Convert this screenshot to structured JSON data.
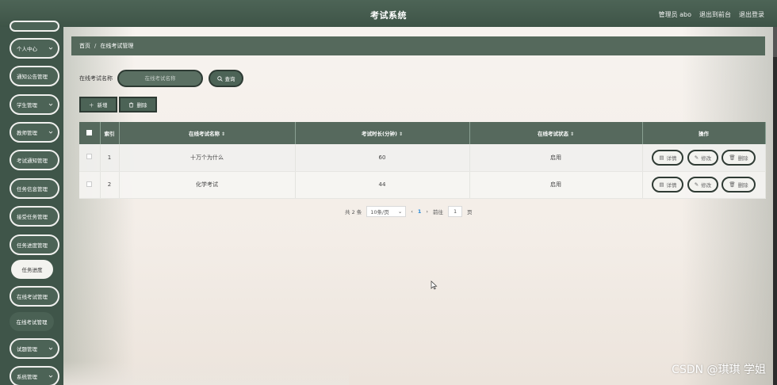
{
  "app": {
    "title": "考试系统",
    "user": "管理员 abo",
    "back_link": "退出到前台",
    "logout": "退出登录"
  },
  "sidebar": {
    "items": [
      {
        "label": "个人中心"
      },
      {
        "label": "通知公告管理"
      },
      {
        "label": "学生管理"
      },
      {
        "label": "教师管理"
      },
      {
        "label": "考试通知管理"
      },
      {
        "label": "任务信息管理"
      },
      {
        "label": "接受任务管理"
      },
      {
        "label": "任务进度管理"
      },
      {
        "label": "任务进度"
      },
      {
        "label": "在线考试管理"
      },
      {
        "label": "在线考试管理"
      },
      {
        "label": "试题管理"
      },
      {
        "label": "系统管理"
      }
    ]
  },
  "breadcrumb": {
    "home": "首页",
    "separator": "/",
    "current": "在线考试管理"
  },
  "search": {
    "label": "在线考试名称",
    "placeholder": "在线考试名称",
    "button": "查询"
  },
  "actions": {
    "add": "新增",
    "delete": "删除"
  },
  "table": {
    "headers": {
      "index": "索引",
      "name": "在线考试名称",
      "duration": "考试时长(分钟)",
      "status": "在线考试状态",
      "ops": "操作"
    },
    "rows": [
      {
        "index": "1",
        "name": "十万个为什么",
        "duration": "60",
        "status": "启用"
      },
      {
        "index": "2",
        "name": "化学考试",
        "duration": "44",
        "status": "启用"
      }
    ],
    "op_labels": {
      "detail": "详情",
      "edit": "修改",
      "delete": "删除"
    }
  },
  "pagination": {
    "total": "共 2 条",
    "page_size": "10条/页",
    "current_page": "1",
    "goto_label": "前往",
    "goto_value": "1",
    "page_suffix": "页"
  },
  "watermark": "CSDN @琪琪 学姐",
  "colors": {
    "header": "#4d6456",
    "sidebar": "#3f5549",
    "table_header": "#56695d",
    "accent_page": "#2a8bd8"
  }
}
